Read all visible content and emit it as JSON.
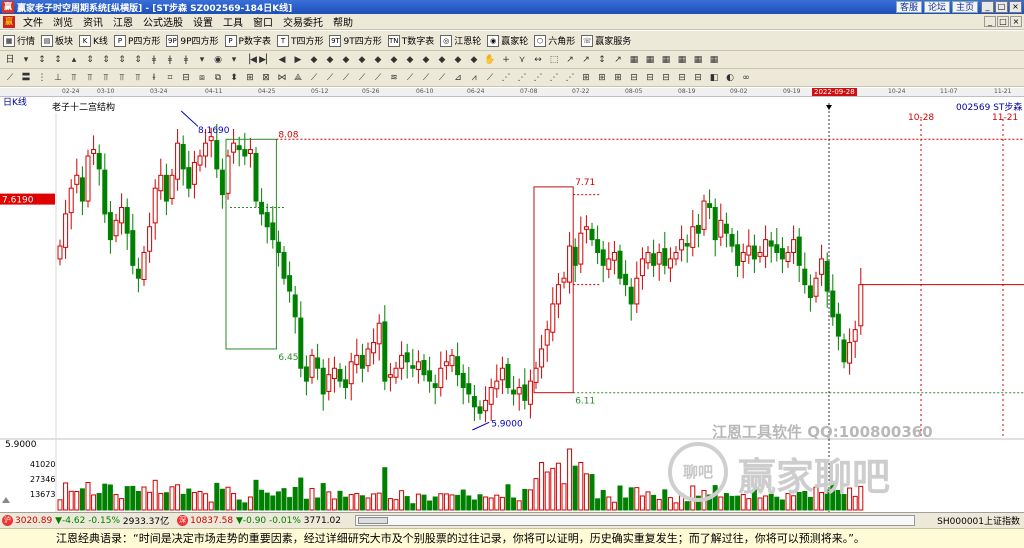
{
  "window": {
    "app_title": "赢家老子时空周期系统[纵横版] - [ST步森  SZ002569-184日K线]",
    "links": [
      "客服",
      "论坛",
      "主页"
    ],
    "controls": [
      "_",
      "□",
      "×"
    ]
  },
  "menu": {
    "items": [
      "文件",
      "浏览",
      "资讯",
      "江恩",
      "公式选股",
      "设置",
      "工具",
      "窗口",
      "交易委托",
      "帮助"
    ],
    "mdi_controls": [
      "_",
      "□",
      "×"
    ]
  },
  "toolbar1": {
    "items": [
      {
        "label": "行情",
        "icon": "grid-icon"
      },
      {
        "label": "板块",
        "icon": "blocks-icon"
      },
      {
        "label": "K线",
        "icon": "candle-icon"
      },
      {
        "label": "P四方形",
        "icon": "p-square-icon"
      },
      {
        "label": "9P四方形",
        "icon": "9p-square-icon"
      },
      {
        "label": "P数字表",
        "icon": "p-number-icon"
      },
      {
        "label": "T四方形",
        "icon": "t-square-icon"
      },
      {
        "label": "9T四方形",
        "icon": "9t-square-icon"
      },
      {
        "label": "T数字表",
        "icon": "t-number-icon"
      },
      {
        "label": "江恩轮",
        "icon": "gann-wheel-icon"
      },
      {
        "label": "赢家轮",
        "icon": "winner-wheel-icon"
      },
      {
        "label": "六角形",
        "icon": "hexagon-icon"
      },
      {
        "label": "赢家服务",
        "icon": "service-icon"
      }
    ],
    "icon_glyphs": [
      "▦",
      "▤",
      "K",
      "P",
      "9P",
      "P",
      "T",
      "9T",
      "TN",
      "◎",
      "◉",
      "⬡",
      "☏"
    ]
  },
  "toolbar2": {
    "buttons": [
      "日",
      "▾",
      "↕",
      "↕",
      "▴",
      "⇕",
      "⇕",
      "⇕",
      "⇕",
      "ǂ",
      "ǂ",
      "ǂ",
      "▾",
      "◉",
      "▾",
      "▕◀",
      "▶▏",
      "◀",
      "▶",
      "◆",
      "◆",
      "◆",
      "◆",
      "◆",
      "◆",
      "◆",
      "◆",
      "◆",
      "◆",
      "◆",
      "✋",
      "+",
      "⋎",
      "↔",
      "⬚",
      "↗",
      "↗",
      "↕",
      "↗",
      "▦",
      "▦",
      "▦",
      "▦",
      "▦",
      "▦"
    ]
  },
  "toolbar3": {
    "buttons": [
      "⟋",
      "〓",
      "⋮",
      "⊥",
      "⫪",
      "⫪",
      "⫪",
      "⫪",
      "⫪",
      "Ɨ",
      "⌗",
      "⊟",
      "⧈",
      "⧉",
      "⬍",
      "⊞",
      "⊠",
      "⋈",
      "⟁",
      "⟋",
      "⟋",
      "⟋",
      "⟋",
      "⟋",
      "≋",
      "⟋",
      "⟋",
      "⟋",
      "⊿",
      "⩘",
      "⟋",
      "⋰",
      "⋰",
      "⋰",
      "⋰",
      "⋰",
      "⊞",
      "⊞",
      "⊞",
      "⊟",
      "⊟",
      "⊟",
      "⊟",
      "⊟",
      "◧",
      "◐",
      "∞"
    ]
  },
  "date_axis": {
    "labels": [
      "02-24",
      "03-10",
      "03-24",
      "04-11",
      "04-25",
      "05-12",
      "05-26",
      "06-10",
      "06-24",
      "07-08",
      "07-22",
      "08-05",
      "08-19",
      "09-02",
      "09-19",
      "2022-09-28",
      "10-24",
      "11-07",
      "11-21"
    ],
    "highlight": "2022-09-28"
  },
  "chart_header": {
    "period": "日K线",
    "indicator": "老子十二宫结构",
    "code_name": "002569  ST步森"
  },
  "chart_data": {
    "type": "candlestick",
    "price_axis": {
      "current_price_label": "7.6190",
      "low_label": "5.9000"
    },
    "annotations": {
      "high": "8.1690",
      "low": "5.9000",
      "box1_top": "8.08",
      "box1_bottom": "6.45",
      "box2_top": "7.71",
      "box2_bottom": "6.11",
      "date_10_28": "10-28",
      "date_11_21": "11-21"
    },
    "volume_axis": {
      "ticks": [
        "41020",
        "27346",
        "13673"
      ]
    },
    "closes": [
      7.25,
      7.5,
      7.7,
      7.8,
      7.6,
      7.95,
      8.0,
      7.85,
      7.5,
      7.3,
      7.45,
      7.55,
      7.35,
      7.1,
      7.0,
      7.2,
      7.4,
      7.7,
      7.8,
      7.6,
      7.8,
      8.05,
      7.85,
      7.7,
      7.9,
      7.95,
      8.05,
      8.1,
      7.85,
      7.65,
      7.95,
      8.05,
      8.0,
      7.95,
      8.0,
      7.6,
      7.5,
      7.4,
      7.3,
      7.2,
      7.0,
      6.9,
      6.7,
      6.3,
      6.2,
      6.4,
      6.3,
      6.1,
      6.25,
      6.3,
      6.2,
      6.15,
      6.35,
      6.4,
      6.3,
      6.45,
      6.5,
      6.65,
      6.2,
      6.25,
      6.3,
      6.4,
      6.35,
      6.3,
      6.35,
      6.25,
      6.2,
      6.15,
      6.3,
      6.35,
      6.4,
      6.25,
      6.15,
      6.1,
      6.0,
      5.95,
      6.05,
      6.15,
      6.2,
      6.3,
      6.15,
      6.1,
      6.15,
      6.05,
      6.2,
      6.3,
      6.45,
      6.6,
      6.8,
      6.95,
      7.0,
      7.25,
      7.1,
      7.35,
      7.4,
      7.3,
      7.2,
      7.1,
      7.15,
      7.2,
      7.0,
      6.95,
      6.8,
      7.0,
      7.15,
      7.2,
      7.1,
      7.2,
      7.1,
      7.15,
      7.2,
      7.3,
      7.25,
      7.4,
      7.35,
      7.6,
      7.55,
      7.3,
      7.45,
      7.35,
      7.25,
      7.1,
      7.2,
      7.25,
      7.15,
      7.2,
      7.3,
      7.25,
      7.2,
      7.15,
      7.2,
      7.3,
      7.1,
      6.95,
      6.85,
      7.0,
      7.15,
      6.9,
      6.7,
      6.55,
      6.35,
      6.5,
      6.6,
      6.95
    ],
    "ylim": [
      5.75,
      8.3
    ]
  },
  "watermark": {
    "line1": "江恩工具软件  QQ:100800360",
    "logo": "聊吧",
    "line2": "赢家聊吧"
  },
  "statusbar": {
    "index1": {
      "value": "3020.89",
      "change": "▼-4.62",
      "pct": "-0.15%",
      "amount": "2933.37亿"
    },
    "index2": {
      "value": "10837.58",
      "change": "▼-0.90",
      "pct": "-0.01%",
      "amount": "3771.02"
    },
    "right": "SH000001上证指数"
  },
  "quote": {
    "text": "江恩经典语录：“时间是决定市场走势的重要因素，经过详细研究大市及个别股票的过往记录，你将可以证明，历史确实重复发生；而了解过往，你将可以预测将来。”。"
  },
  "colors": {
    "up": "#d00000",
    "down": "#008000",
    "box1": "#2a8a2a",
    "box2": "#c01010",
    "title_bar": "#2a5fcc"
  }
}
